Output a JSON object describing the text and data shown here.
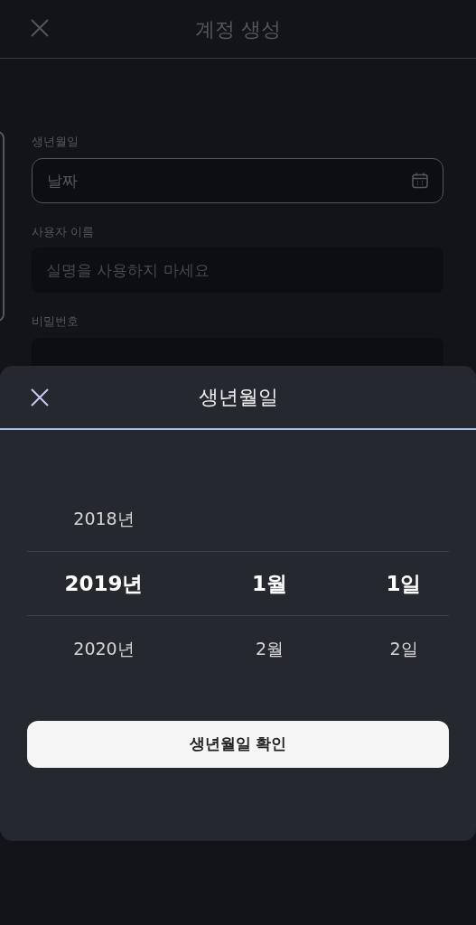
{
  "header": {
    "title": "계정 생성"
  },
  "form": {
    "fields": [
      {
        "kind": "date",
        "label": "생년월일",
        "placeholder": "날짜"
      },
      {
        "kind": "text",
        "label": "사용자 이름",
        "placeholder": "실명을 사용하지 마세요"
      },
      {
        "kind": "password",
        "label": "비밀번호"
      }
    ]
  },
  "sheet": {
    "title": "생년월일",
    "rows": [
      {
        "year": "2018년",
        "selected": false
      },
      {
        "year": "2019년",
        "month": "1월",
        "day": "1일",
        "selected": true
      },
      {
        "year": "2020년",
        "month": "2월",
        "day": "2일",
        "selected": false
      }
    ],
    "confirm_button": "생년월일 확인"
  }
}
